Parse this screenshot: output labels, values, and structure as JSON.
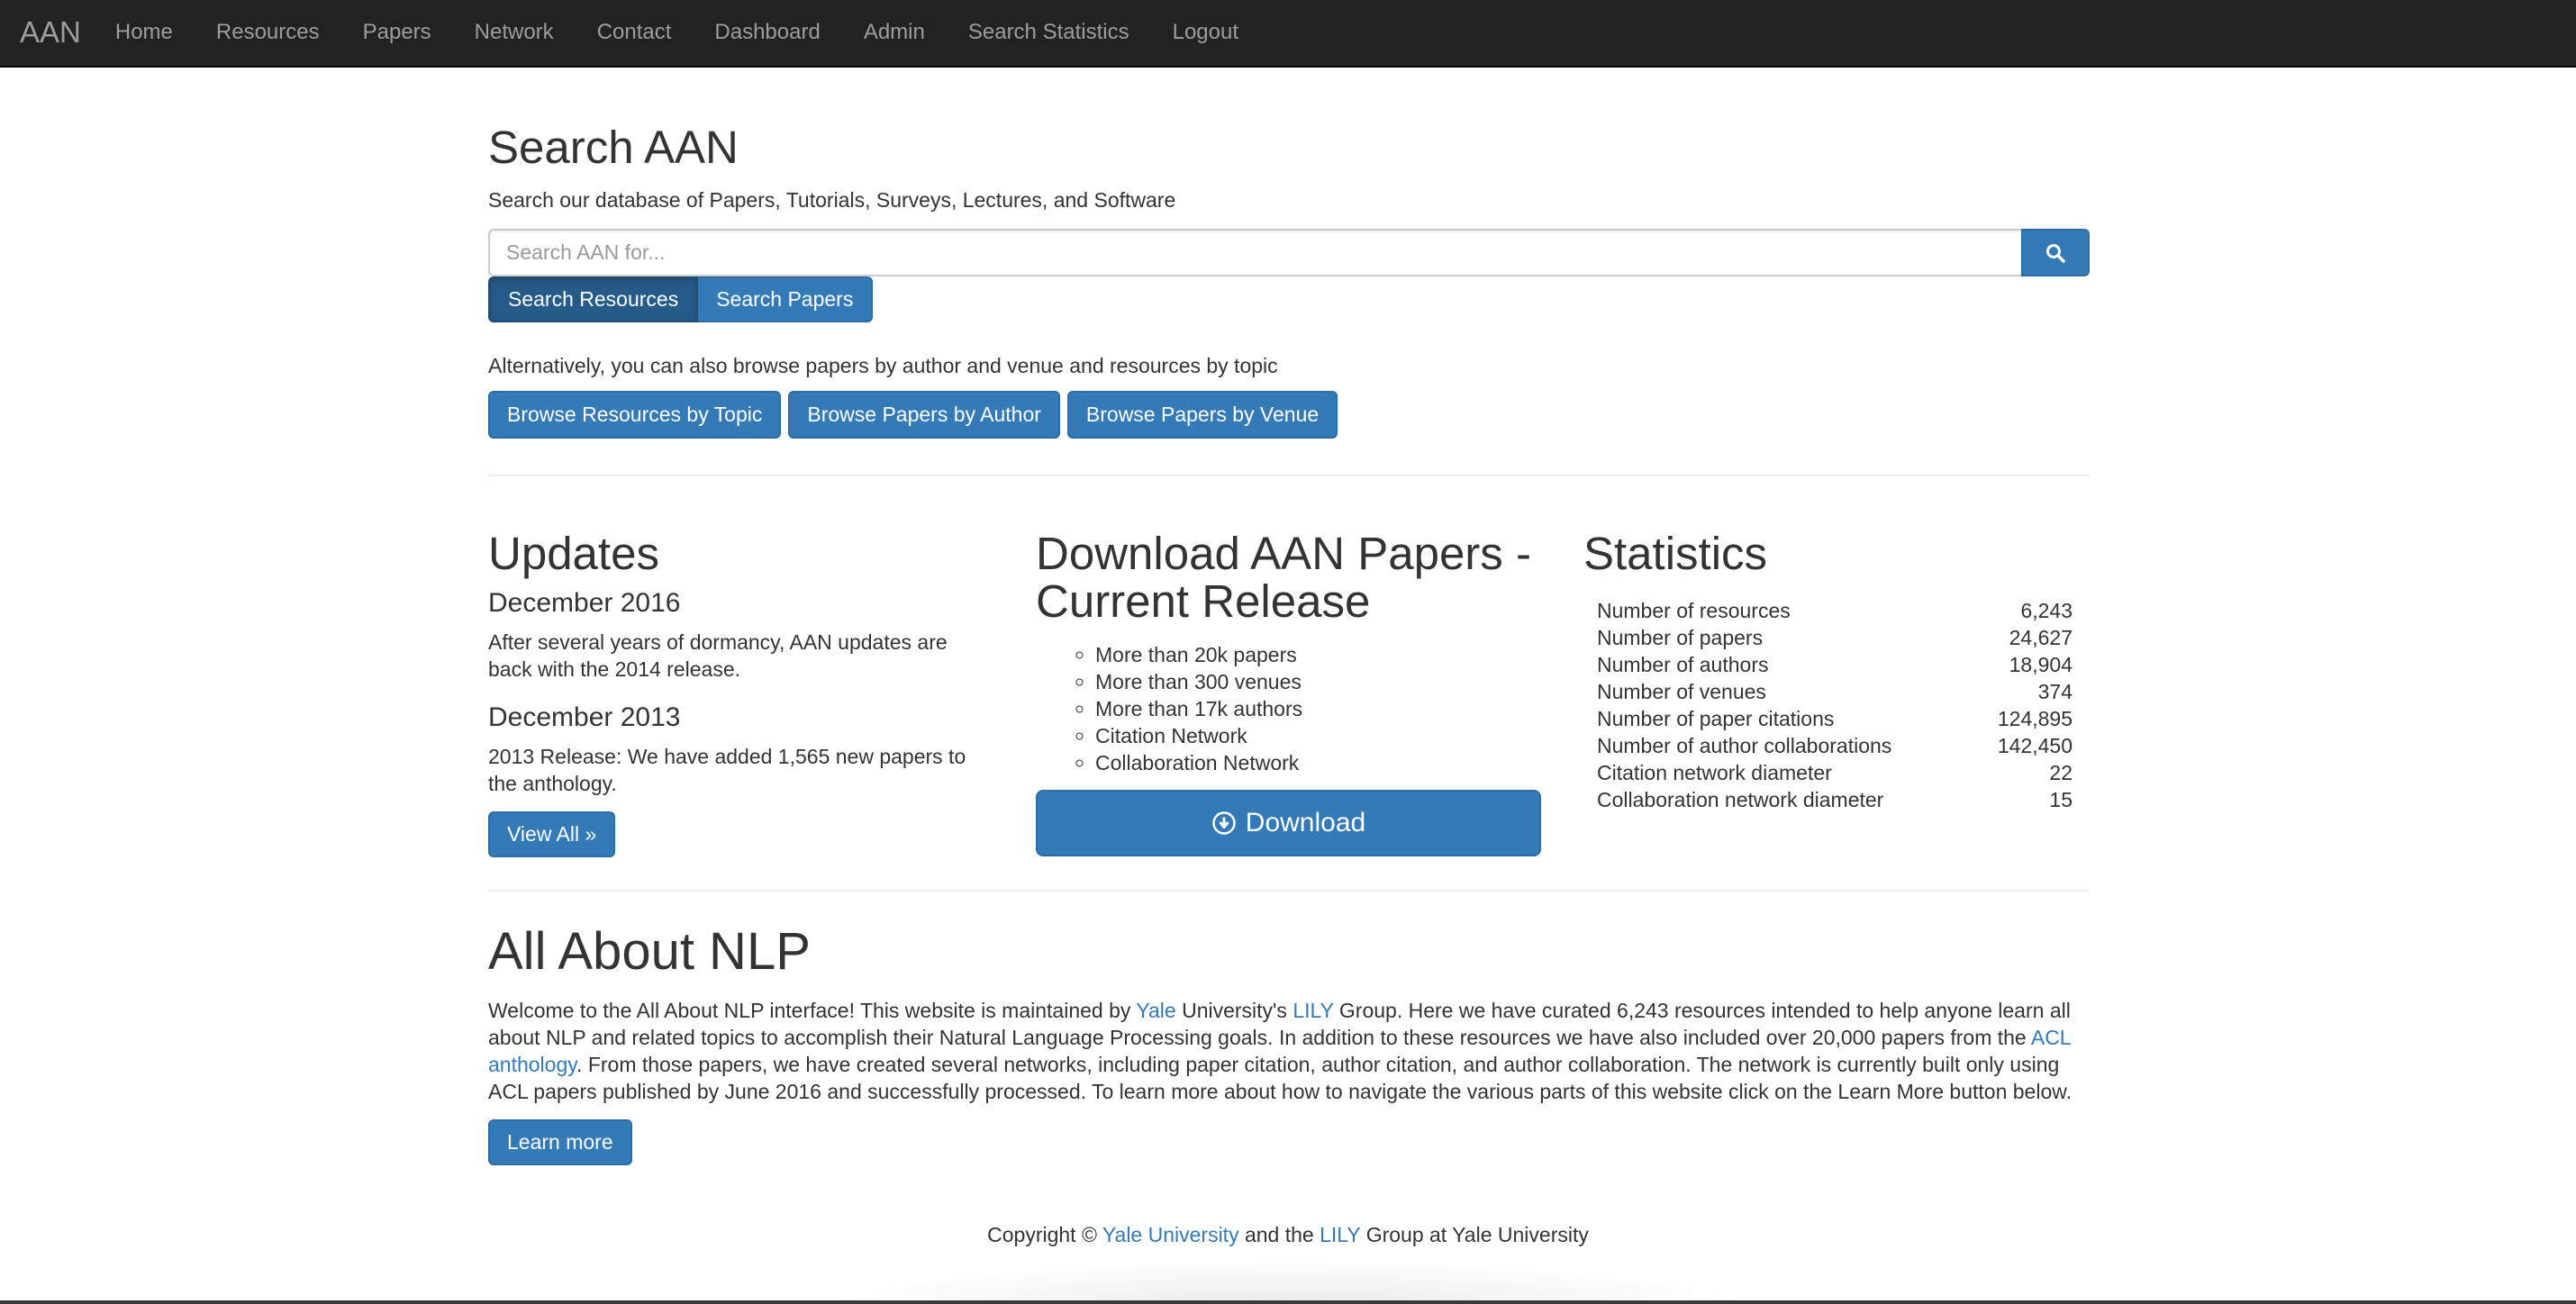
{
  "navbar": {
    "brand": "AAN",
    "links": [
      "Home",
      "Resources",
      "Papers",
      "Network",
      "Contact",
      "Dashboard",
      "Admin",
      "Search Statistics",
      "Logout"
    ]
  },
  "search": {
    "title": "Search AAN",
    "subtitle": "Search our database of Papers, Tutorials, Surveys, Lectures, and Software",
    "placeholder": "Search AAN for...",
    "search_icon": "magnifier-icon",
    "toggle": [
      "Search Resources",
      "Search Papers"
    ],
    "active_toggle": "Search Resources",
    "browse_text": "Alternatively, you can also browse papers by author and venue and resources by topic",
    "browse_buttons": [
      "Browse Resources by Topic",
      "Browse Papers by Author",
      "Browse Papers by Venue"
    ]
  },
  "updates": {
    "title": "Updates",
    "items": [
      {
        "heading": "December 2016",
        "text": "After several years of dormancy, AAN updates are back with the 2014 release."
      },
      {
        "heading": "December 2013",
        "text": "2013 Release: We have added 1,565 new papers to the anthology."
      }
    ],
    "view_all": "View All »"
  },
  "download": {
    "title_line1": "Download AAN Papers -",
    "title_line2": "Current Release",
    "items": [
      "More than 20k papers",
      "More than 300 venues",
      "More than 17k authors",
      "Citation Network",
      "Collaboration Network"
    ],
    "button_label": "Download",
    "button_icon": "download-circle-icon"
  },
  "statistics": {
    "title": "Statistics",
    "rows": [
      {
        "label": "Number of resources",
        "value": "6,243"
      },
      {
        "label": "Number of papers",
        "value": "24,627"
      },
      {
        "label": "Number of authors",
        "value": "18,904"
      },
      {
        "label": "Number of venues",
        "value": "374"
      },
      {
        "label": "Number of paper citations",
        "value": "124,895"
      },
      {
        "label": "Number of author collaborations",
        "value": "142,450"
      },
      {
        "label": "Citation network diameter",
        "value": "22"
      },
      {
        "label": "Collaboration network diameter",
        "value": "15"
      }
    ]
  },
  "about": {
    "title": "All About NLP",
    "t1": "Welcome to the All About NLP interface! This website is maintained by ",
    "link_yale": "Yale",
    "t2": " University's ",
    "link_lily": "LILY",
    "t3": " Group. Here we have curated 6,243 resources intended to help anyone learn all about NLP and related topics to accomplish their Natural Language Processing goals. In addition to these resources we have also included over 20,000 papers from the ",
    "link_acl": "ACL anthology",
    "t4": ". From those papers, we have created several networks, including paper citation, author citation, and author collaboration. The network is currently built only using ACL papers published by June 2016 and successfully processed. To learn more about how to navigate the various parts of this website click on the Learn More button below.",
    "learn_more": "Learn more"
  },
  "footer": {
    "t1": "Copyright © ",
    "link_yale": "Yale University",
    "t2": " and the ",
    "link_lily": "LILY",
    "t3": " Group at Yale University"
  }
}
